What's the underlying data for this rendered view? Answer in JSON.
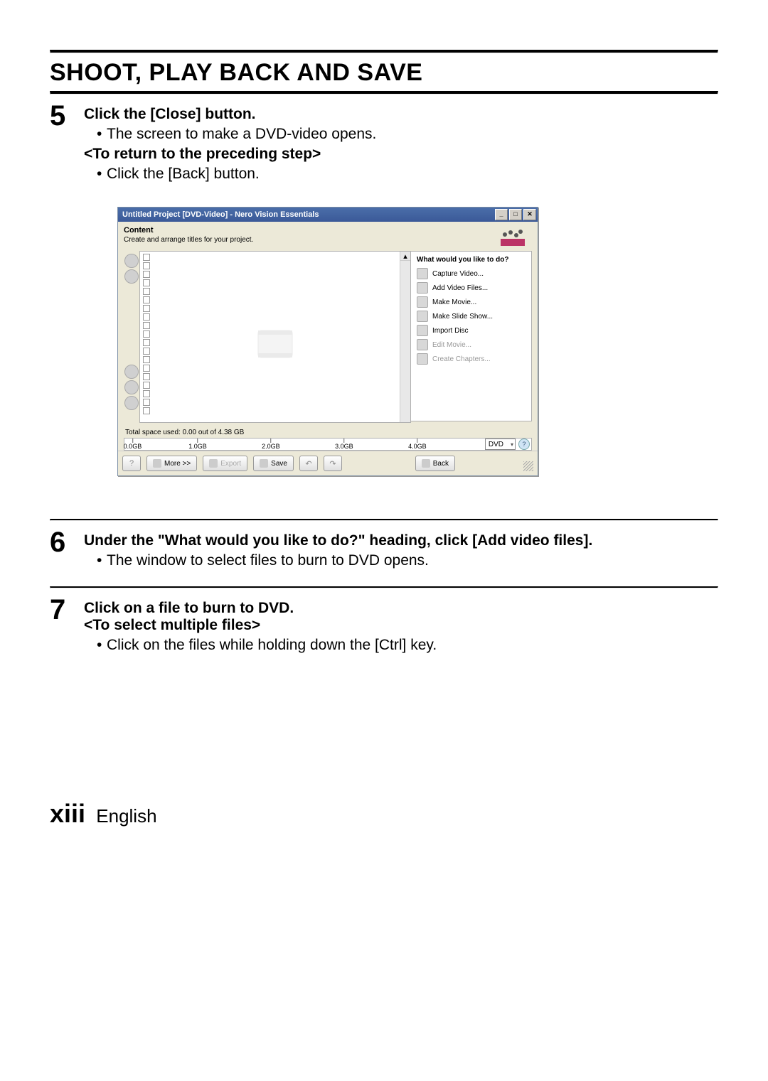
{
  "page": {
    "title": "SHOOT, PLAY BACK AND SAVE",
    "page_number": "xiii",
    "language": "English"
  },
  "step5": {
    "number": "5",
    "heading": "Click the [Close] button.",
    "bullet1": "The screen to make a DVD-video opens.",
    "sub_heading": "<To return to the preceding step>",
    "bullet2": "Click the [Back] button."
  },
  "step6": {
    "number": "6",
    "heading": "Under the \"What would you like to do?\" heading, click [Add video files].",
    "bullet1": "The window to select files to burn to DVD opens."
  },
  "step7": {
    "number": "7",
    "heading": "Click on a file to burn to DVD.",
    "sub_heading": "<To select multiple files>",
    "bullet1": "Click on the files while holding down the [Ctrl] key."
  },
  "screenshot": {
    "window_title": "Untitled Project [DVD-Video] - Nero Vision Essentials",
    "content_heading": "Content",
    "content_sub": "Create and arrange titles for your project.",
    "right_heading": "What would you like to do?",
    "actions": {
      "capture": "Capture Video...",
      "add_files": "Add Video Files...",
      "make_movie": "Make Movie...",
      "make_slideshow": "Make Slide Show...",
      "import_disc": "Import Disc",
      "edit_movie": "Edit Movie...",
      "create_chapters": "Create Chapters..."
    },
    "space_used": "Total space used: 0.00 out of 4.38 GB",
    "ruler": {
      "t0": "0.0GB",
      "t1": "1.0GB",
      "t2": "2.0GB",
      "t3": "3.0GB",
      "t4": "4.0GB"
    },
    "disc_type": "DVD",
    "buttons": {
      "more": "More >>",
      "export": "Export",
      "save": "Save",
      "back": "Back"
    }
  }
}
